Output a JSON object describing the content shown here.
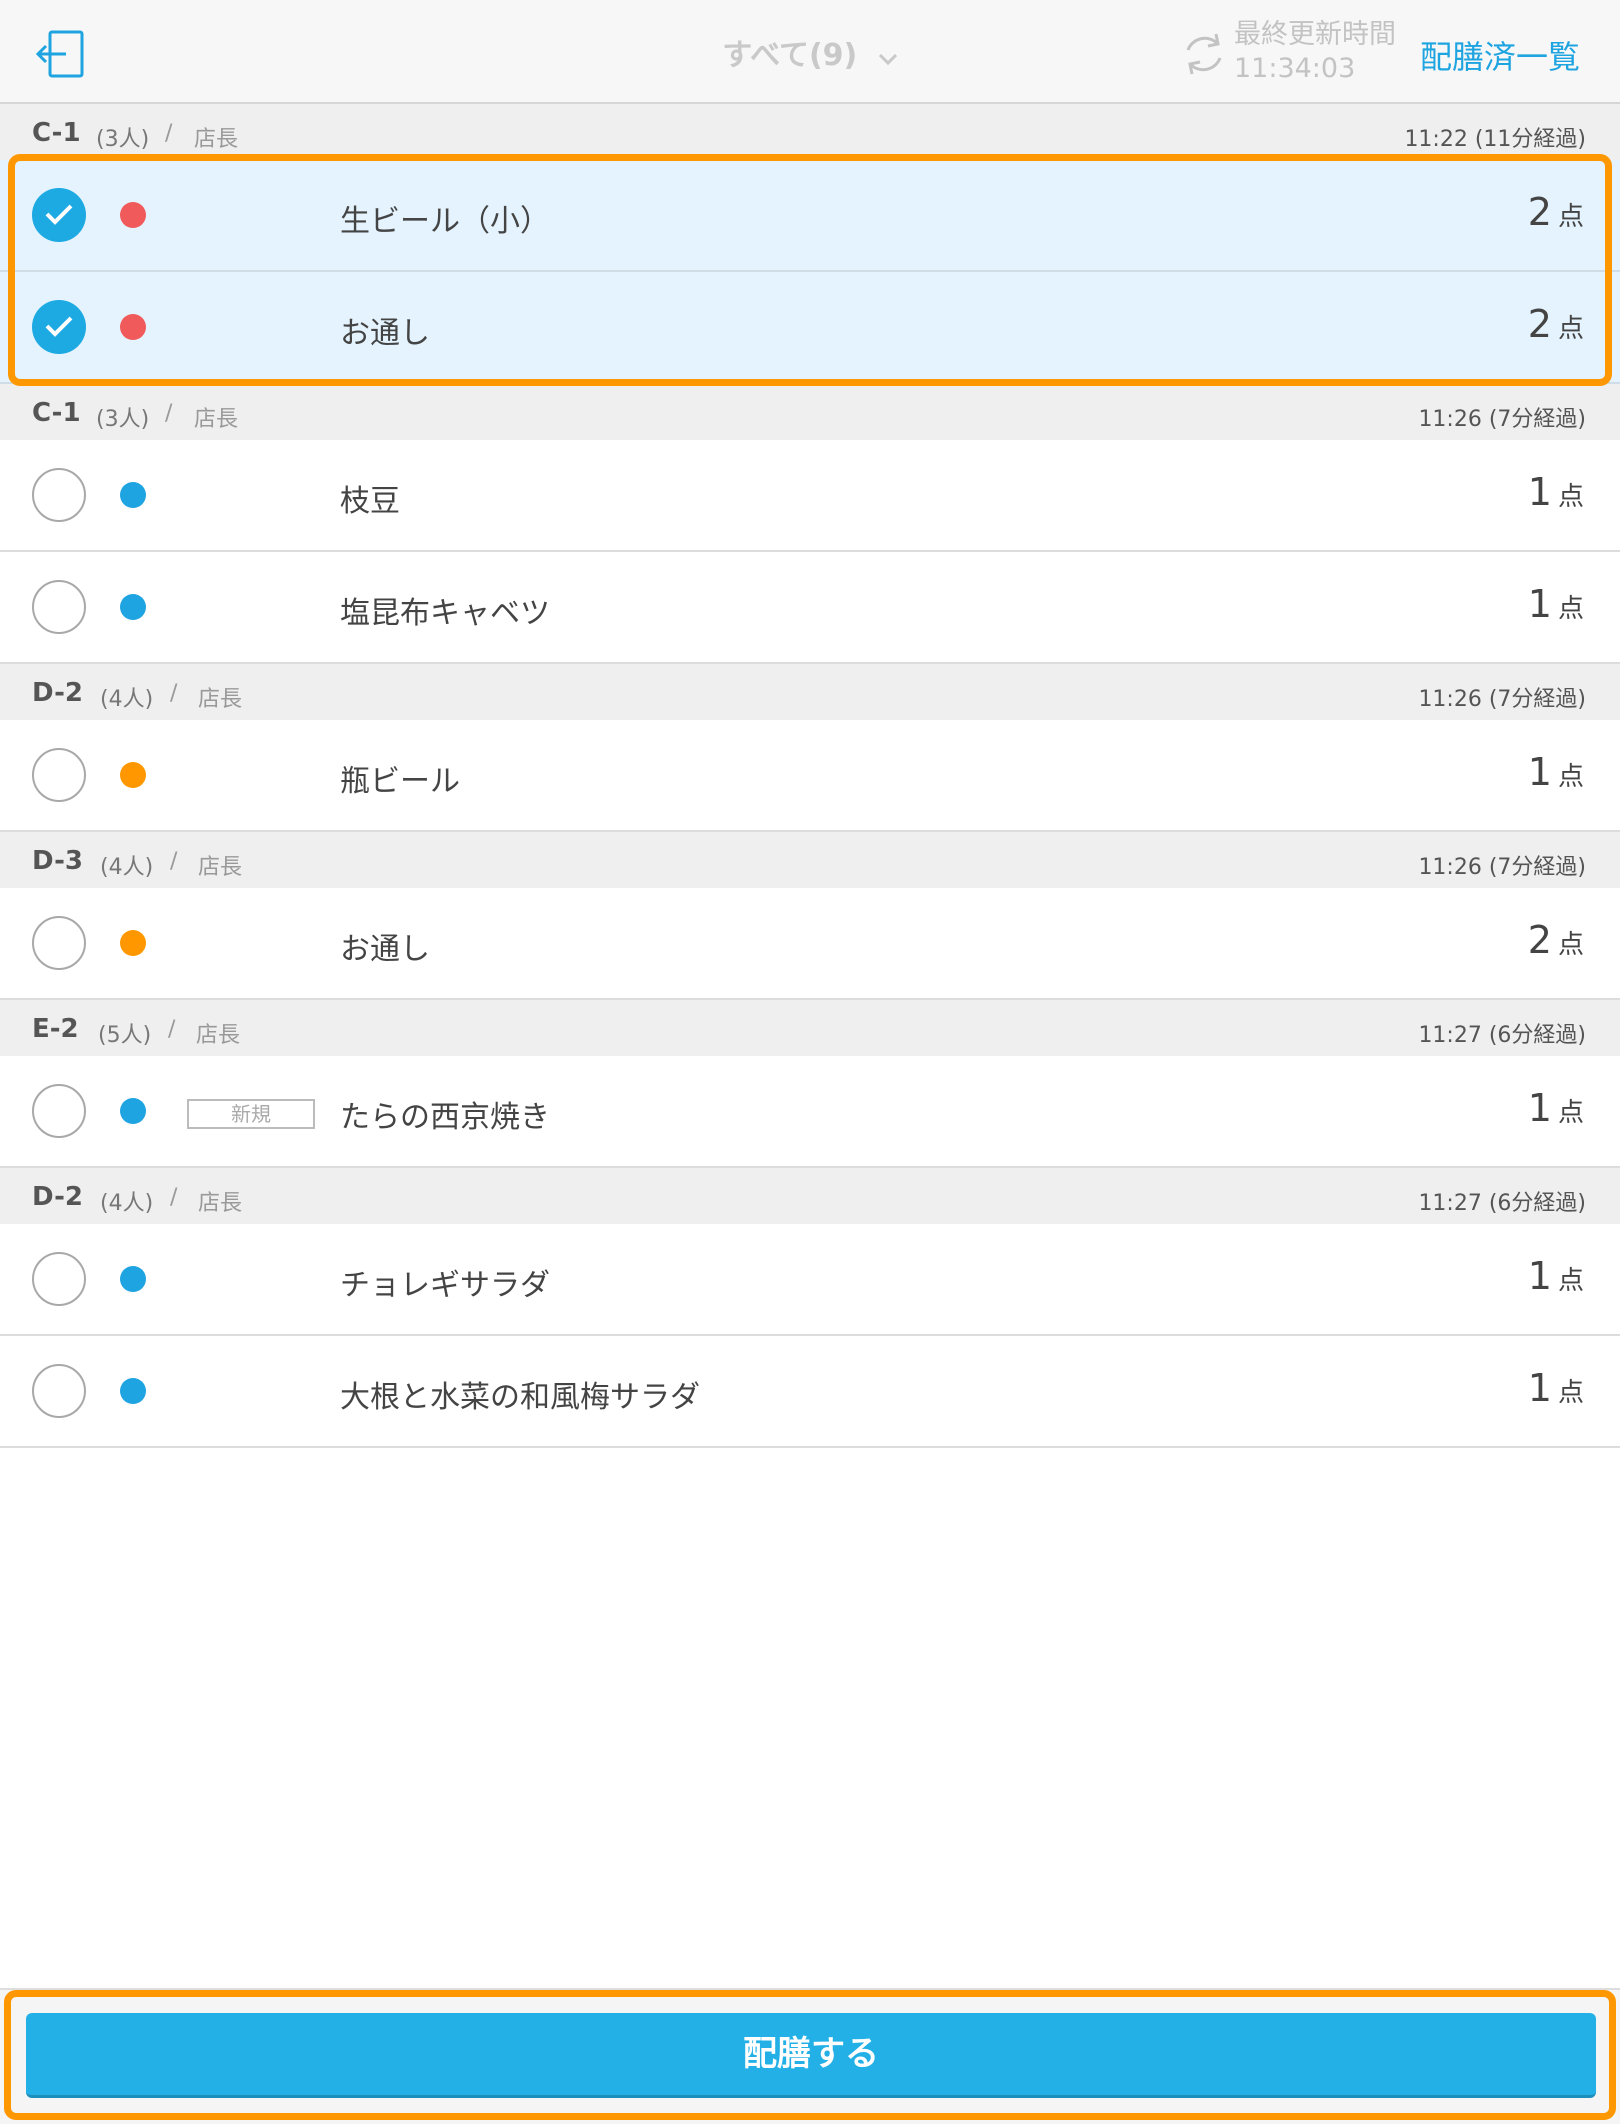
{
  "header": {
    "filter_label": "すべて(9)",
    "updated_label": "最終更新時間",
    "updated_time": "11:34:03",
    "delivered_list_link": "配膳済一覧"
  },
  "groups": [
    {
      "table": "C-1",
      "people": "(3人)",
      "sep": "/",
      "staff": "店長",
      "time": "11:22 (11分経過)"
    },
    {
      "table": "C-1",
      "people": "(3人)",
      "sep": "/",
      "staff": "店長",
      "time": "11:26 (7分経過)"
    },
    {
      "table": "D-2",
      "people": "(4人)",
      "sep": "/",
      "staff": "店長",
      "time": "11:26 (7分経過)"
    },
    {
      "table": "D-3",
      "people": "(4人)",
      "sep": "/",
      "staff": "店長",
      "time": "11:26 (7分経過)"
    },
    {
      "table": "E-2",
      "people": "(5人)",
      "sep": "/",
      "staff": "店長",
      "time": "11:27 (6分経過)"
    },
    {
      "table": "D-2",
      "people": "(4人)",
      "sep": "/",
      "staff": "店長",
      "time": "11:27 (6分経過)"
    }
  ],
  "items": [
    {
      "name": "生ビール（小）",
      "qty": "2",
      "unit": "点",
      "checked": true,
      "dot_color": "#f05a5a"
    },
    {
      "name": "お通し",
      "qty": "2",
      "unit": "点",
      "checked": true,
      "dot_color": "#f05a5a"
    },
    {
      "name": "枝豆",
      "qty": "1",
      "unit": "点",
      "checked": false,
      "dot_color": "#1ea4e0"
    },
    {
      "name": "塩昆布キャベツ",
      "qty": "1",
      "unit": "点",
      "checked": false,
      "dot_color": "#1ea4e0"
    },
    {
      "name": "瓶ビール",
      "qty": "1",
      "unit": "点",
      "checked": false,
      "dot_color": "#ff9800"
    },
    {
      "name": "お通し",
      "qty": "2",
      "unit": "点",
      "checked": false,
      "dot_color": "#ff9800"
    },
    {
      "name": "たらの西京焼き",
      "qty": "1",
      "unit": "点",
      "checked": false,
      "dot_color": "#1ea4e0",
      "badge": "新規"
    },
    {
      "name": "チョレギサラダ",
      "qty": "1",
      "unit": "点",
      "checked": false,
      "dot_color": "#1ea4e0"
    },
    {
      "name": "大根と水菜の和風梅サラダ",
      "qty": "1",
      "unit": "点",
      "checked": false,
      "dot_color": "#1ea4e0"
    }
  ],
  "footer": {
    "deliver_button": "配膳する"
  },
  "colors": {
    "accent": "#1ea4e0",
    "highlight": "#ff9800",
    "selected_row": "#e4f3fd"
  }
}
